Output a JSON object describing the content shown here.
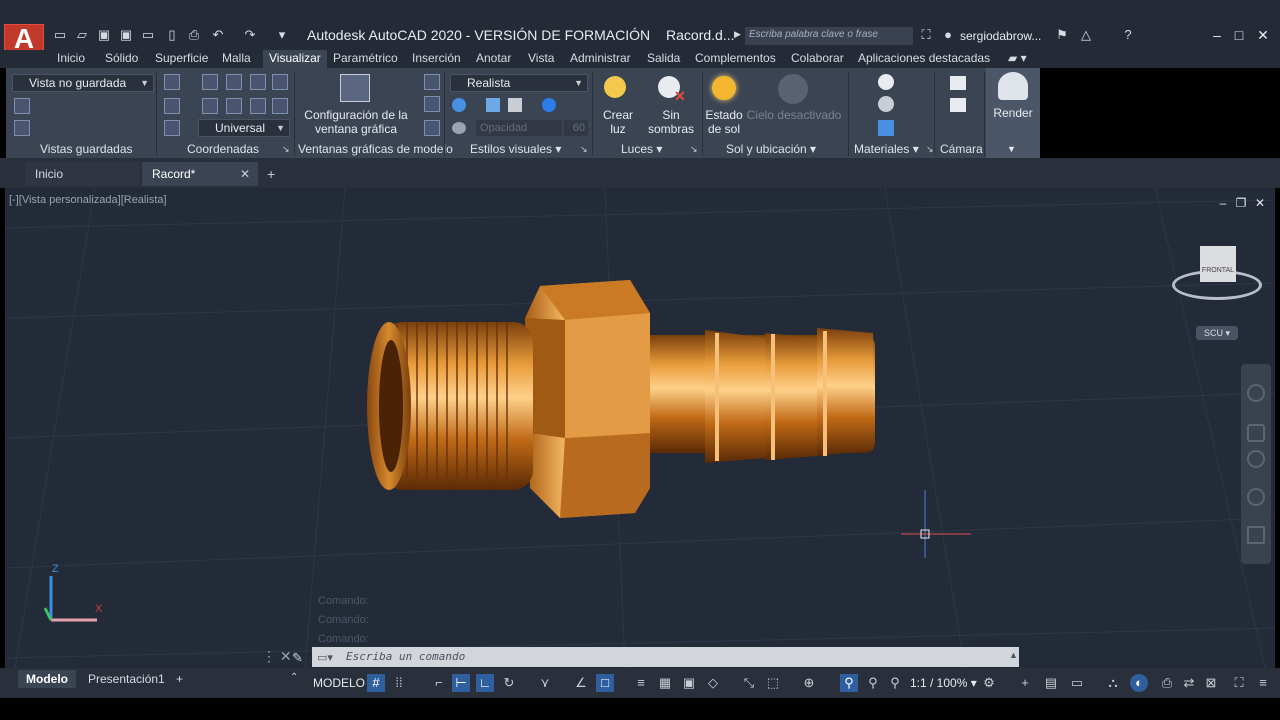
{
  "title_bar": {
    "app_title": "Autodesk AutoCAD 2020 - VERSIÓN DE FORMACIÓN",
    "document": "Racord.d...",
    "search_placeholder": "Escriba palabra clave o frase",
    "user": "sergiodabrow..."
  },
  "menu_tabs": [
    "Inicio",
    "Sólido",
    "Superficie",
    "Malla",
    "Visualizar",
    "Paramétrico",
    "Inserción",
    "Anotar",
    "Vista",
    "Administrar",
    "Salida",
    "Complementos",
    "Colaborar",
    "Aplicaciones destacadas"
  ],
  "active_menu_tab": "Visualizar",
  "ribbon": {
    "saved_view_combo": "Vista no guardada",
    "ucs_combo": "Universal",
    "viewport_config_label_1": "Configuración de la",
    "viewport_config_label_2": "ventana gráfica",
    "visual_style_combo": "Realista",
    "opacity_label": "Opacidad",
    "opacity_value": "60",
    "create_light_1": "Crear",
    "create_light_2": "luz",
    "no_shadows_1": "Sin",
    "no_shadows_2": "sombras",
    "sun_state_1": "Estado",
    "sun_state_2": "de sol",
    "sky_off": "Cielo desactivado",
    "render": "Render",
    "panels": {
      "saved_views": "Vistas guardadas",
      "coordinates": "Coordenadas",
      "model_viewports": "Ventanas gráficas de modelo",
      "visual_styles": "Estilos visuales",
      "lights": "Luces",
      "sun_location": "Sol y ubicación",
      "materials": "Materiales",
      "camera": "Cámara"
    }
  },
  "doc_tabs": {
    "start": "Inicio",
    "current": "Racord*"
  },
  "viewport": {
    "label": "[-][Vista personalizada][Realista]",
    "viewcube_face": "FRONTAL",
    "ucs_button": "SCU",
    "axis_z": "Z",
    "axis_x": "X"
  },
  "command": {
    "history": [
      "Comando:",
      "Comando:",
      "Comando:"
    ],
    "placeholder": "Escriba un comando"
  },
  "status": {
    "layout_tabs": [
      "Modelo",
      "Presentación1"
    ],
    "active_layout": "Modelo",
    "model_button": "MODELO",
    "scale": "1:1 / 100%"
  },
  "colors": {
    "accent_blue": "#2f5f9e",
    "part_copper": "#c97a22",
    "viewport_bg": "#232b38"
  }
}
